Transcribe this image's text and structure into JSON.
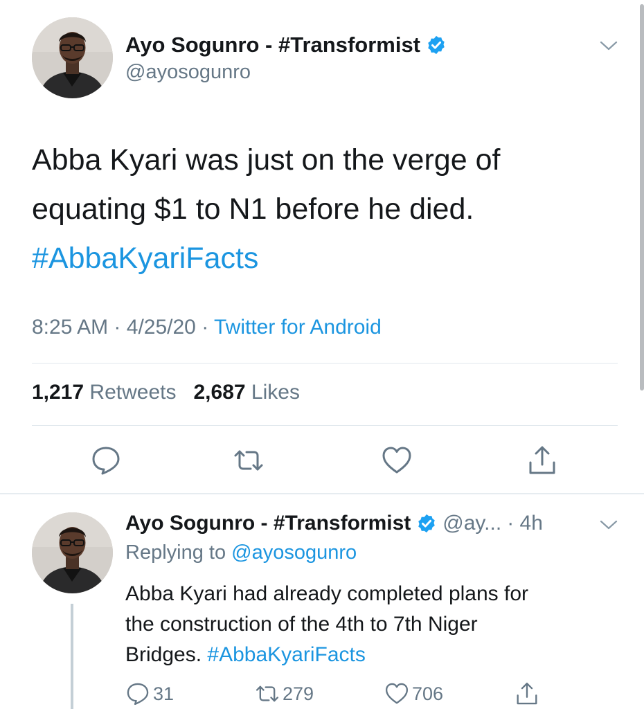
{
  "colors": {
    "link": "#1b95e0",
    "muted": "#657786",
    "text": "#14171a",
    "divider": "#e1e8ed",
    "verified": "#1da1f2"
  },
  "main_tweet": {
    "display_name": "Ayo Sogunro - #Transformist",
    "handle": "@ayosogunro",
    "verified_icon": "verified-badge-icon",
    "text_lines": [
      "Abba Kyari was just on the verge of",
      "equating $1 to N1 before he died."
    ],
    "hashtag": "#AbbaKyariFacts",
    "time": "8:25 AM",
    "date": "4/25/20",
    "separator": "·",
    "source": "Twitter for Android",
    "retweet_count": "1,217",
    "retweet_label": "Retweets",
    "like_count": "2,687",
    "like_label": "Likes",
    "actions": [
      "reply-icon",
      "retweet-icon",
      "like-icon",
      "share-icon"
    ]
  },
  "reply_tweet": {
    "display_name": "Ayo Sogunro - #Transformist",
    "handle_truncated": "@ay...",
    "time_ago": "· 4h",
    "replying_label": "Replying to",
    "replying_mention": "@ayosogunro",
    "text_lines": [
      "Abba Kyari had already completed plans for",
      "the construction of the 4th to 7th Niger",
      "Bridges."
    ],
    "hashtag": "#AbbaKyariFacts",
    "reply_count": "31",
    "retweet_count": "279",
    "like_count": "706"
  }
}
